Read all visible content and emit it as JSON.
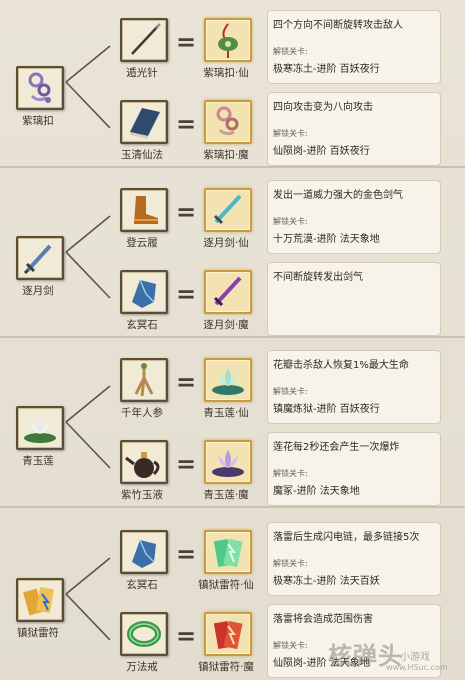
{
  "sections": [
    {
      "base": {
        "name": "紫璃扣",
        "icon": "purple-jade-pendant-icon"
      },
      "branches": [
        {
          "material": {
            "name": "遁光针",
            "icon": "needle-icon"
          },
          "result": {
            "name": "紫璃扣·仙",
            "icon": "pendant-immortal-icon"
          },
          "effect": "四个方向不间断旋转攻击敌人",
          "unlock_label": "解锁关卡:",
          "stages": "极寒冻土-进阶  百妖夜行"
        },
        {
          "material": {
            "name": "玉清仙法",
            "icon": "book-icon"
          },
          "result": {
            "name": "紫璃扣·魔",
            "icon": "pendant-demon-icon"
          },
          "effect": "四向攻击变为八向攻击",
          "unlock_label": "解锁关卡:",
          "stages": "仙陨岗-进阶  百妖夜行"
        }
      ]
    },
    {
      "base": {
        "name": "逐月剑",
        "icon": "sword-icon"
      },
      "branches": [
        {
          "material": {
            "name": "登云履",
            "icon": "boot-icon"
          },
          "result": {
            "name": "逐月剑·仙",
            "icon": "sword-immortal-icon"
          },
          "effect": "发出一道威力强大的金色剑气",
          "unlock_label": "解锁关卡:",
          "stages": "十万荒漠-进阶  法天象地"
        },
        {
          "material": {
            "name": "玄冥石",
            "icon": "blue-stone-icon"
          },
          "result": {
            "name": "逐月剑·魔",
            "icon": "sword-demon-icon"
          },
          "effect": "不间断旋转发出剑气",
          "unlock_label": "",
          "stages": ""
        }
      ]
    },
    {
      "base": {
        "name": "青玉莲",
        "icon": "lotus-icon"
      },
      "branches": [
        {
          "material": {
            "name": "千年人参",
            "icon": "ginseng-icon"
          },
          "result": {
            "name": "青玉莲·仙",
            "icon": "lotus-immortal-icon"
          },
          "effect": "花瓣击杀敌人恢复1%最大生命",
          "unlock_label": "解锁关卡:",
          "stages": "镇魔炼狱-进阶  百妖夜行"
        },
        {
          "material": {
            "name": "紫竹玉液",
            "icon": "teapot-icon"
          },
          "result": {
            "name": "青玉莲·魔",
            "icon": "lotus-demon-icon"
          },
          "effect": "莲花每2秒还会产生一次爆炸",
          "unlock_label": "解锁关卡:",
          "stages": "魔冢-进阶  法天象地"
        }
      ]
    },
    {
      "base": {
        "name": "镇狱雷符",
        "icon": "talisman-icon"
      },
      "branches": [
        {
          "material": {
            "name": "玄冥石",
            "icon": "blue-stone-icon"
          },
          "result": {
            "name": "镇狱雷符·仙",
            "icon": "talisman-immortal-icon"
          },
          "effect": "落雷后生成闪电链，最多链接5次",
          "unlock_label": "解锁关卡:",
          "stages": "极寒冻土-进阶  法天百妖"
        },
        {
          "material": {
            "name": "万法戒",
            "icon": "jade-ring-icon"
          },
          "result": {
            "name": "镇狱雷符·魔",
            "icon": "talisman-demon-icon"
          },
          "effect": "落雷将会造成范围伤害",
          "unlock_label": "解锁关卡:",
          "stages": "仙陨岗-进阶  法天象地"
        }
      ]
    }
  ],
  "equals_sign": "=",
  "watermark": {
    "main": "核弹头",
    "sub": "小游戏",
    "url": "www.HSuc.com"
  },
  "colors": {
    "background": "#e6e1d4",
    "slot_border": "#5a4d3c",
    "result_border": "#c99a3e",
    "text": "#2e2820"
  }
}
